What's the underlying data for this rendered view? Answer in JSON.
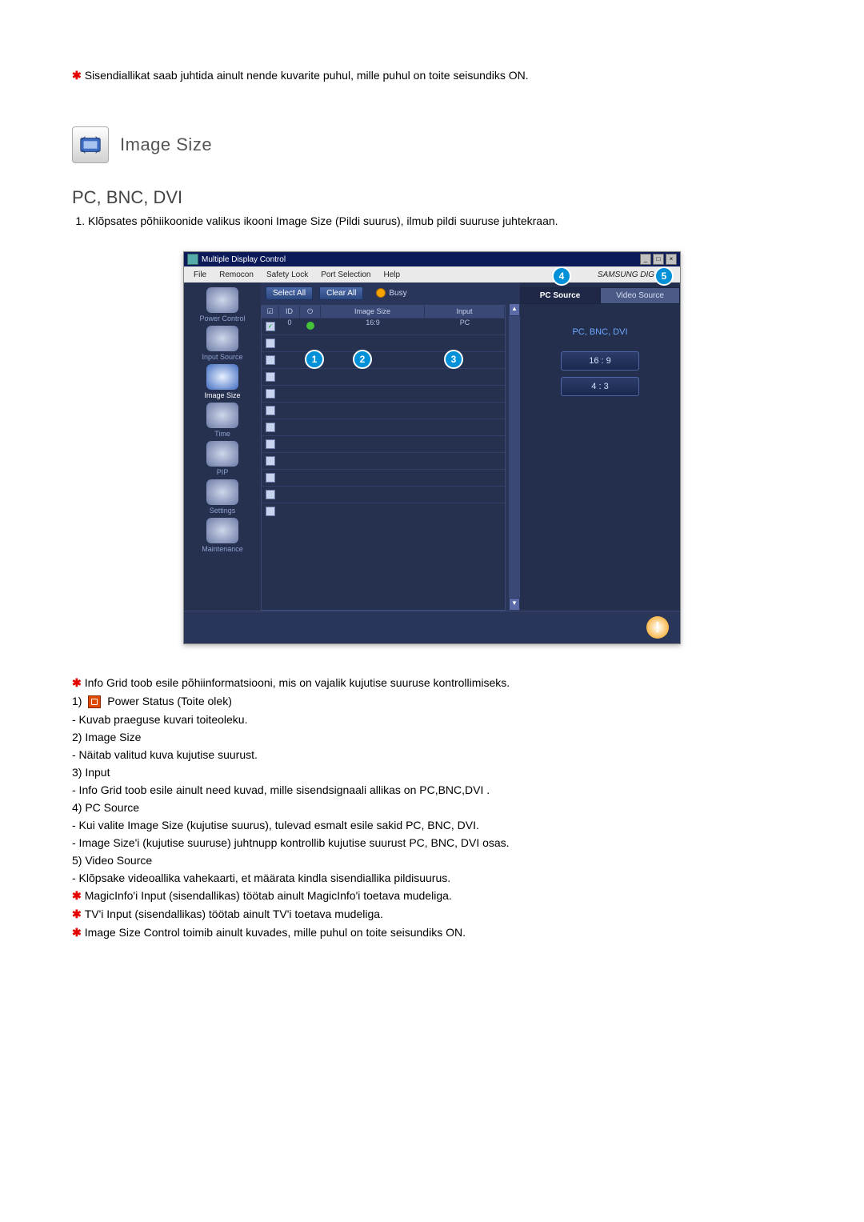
{
  "intro_note": "Sisendiallikat saab juhtida ainult nende kuvarite puhul, mille puhul on toite seisundiks ON.",
  "section": {
    "title": "Image Size"
  },
  "subtitle": "PC, BNC, DVI",
  "numbered": {
    "1": "Klõpsates põhiikoonide valikus ikooni Image Size (Pildi suurus), ilmub pildi suuruse juhtekraan."
  },
  "app": {
    "window_title": "Multiple Display Control",
    "menus": [
      "File",
      "Remocon",
      "Safety Lock",
      "Port Selection",
      "Help"
    ],
    "brand": "SAMSUNG DIGITall",
    "toolbar": {
      "select_all": "Select All",
      "clear_all": "Clear All",
      "busy": "Busy"
    },
    "grid_headers": {
      "id": "ID",
      "image_size": "Image Size",
      "input": "Input"
    },
    "row1": {
      "id": "0",
      "image_size": "16:9",
      "input": "PC"
    },
    "sidebar": {
      "items": [
        {
          "label": "Power Control"
        },
        {
          "label": "Input Source"
        },
        {
          "label": "Image Size"
        },
        {
          "label": "Time"
        },
        {
          "label": "PIP"
        },
        {
          "label": "Settings"
        },
        {
          "label": "Maintenance"
        }
      ]
    },
    "right": {
      "tab_pc": "PC Source",
      "tab_video": "Video Source",
      "source_title": "PC, BNC, DVI",
      "ratio1": "16 : 9",
      "ratio2": "4 : 3"
    },
    "callouts": {
      "c1": "1",
      "c2": "2",
      "c3": "3",
      "c4": "4",
      "c5": "5"
    }
  },
  "descriptions": {
    "lead": "Info Grid toob esile põhiinformatsiooni, mis on vajalik kujutise suuruse kontrollimiseks.",
    "i1_label": "Power Status (Toite olek)",
    "i1_sub": "- Kuvab praeguse kuvari toiteoleku.",
    "i2_label": "Image Size",
    "i2_sub": "- Näitab valitud kuva kujutise suurust.",
    "i3_label": "Input",
    "i3_sub": "- Info Grid toob esile ainult need kuvad, mille sisendsignaali allikas on PC,BNC,DVI .",
    "i4_label": "PC Source",
    "i4_sub_a": "- Kui valite Image Size (kujutise suurus), tulevad esmalt esile sakid PC, BNC, DVI.",
    "i4_sub_b": "- Image Size'i (kujutise suuruse) juhtnupp kontrollib kujutise suurust PC, BNC, DVI osas.",
    "i5_label": "Video Source",
    "i5_sub": "- Klõpsake videoallika vahekaarti, et määrata kindla sisendiallika pildisuurus.",
    "n1": "MagicInfo'i Input (sisendallikas) töötab ainult MagicInfo'i toetava mudeliga.",
    "n2": "TV'i Input (sisendallikas) töötab ainult TV'i toetava mudeliga.",
    "n3": "Image Size Control toimib ainult kuvades, mille puhul on toite seisundiks ON."
  },
  "nums": {
    "n1": "1)",
    "n2": "2)",
    "n3": "3)",
    "n4": "4)",
    "n5": "5)"
  }
}
